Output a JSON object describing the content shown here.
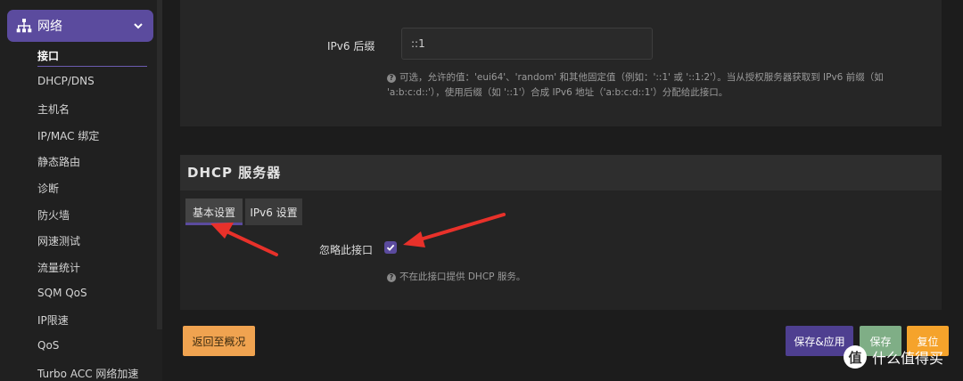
{
  "sidebar": {
    "group_label": "网络",
    "items": [
      {
        "label": "接口",
        "active": true
      },
      {
        "label": "DHCP/DNS"
      },
      {
        "label": "主机名"
      },
      {
        "label": "IP/MAC 绑定"
      },
      {
        "label": "静态路由"
      },
      {
        "label": "诊断"
      },
      {
        "label": "防火墙"
      },
      {
        "label": "网速测试"
      },
      {
        "label": "流量统计"
      },
      {
        "label": "SQM QoS"
      },
      {
        "label": "IP限速"
      },
      {
        "label": "QoS"
      },
      {
        "label": "Turbo ACC 网络加速"
      }
    ]
  },
  "ipv6": {
    "suffix_label": "IPv6 后缀",
    "suffix_value": "::1",
    "hint_line1": "可选，允许的值：'eui64'、'random' 和其他固定值（例如：'::1' 或 '::1:2'）。当从授权服务器获取到 IPv6 前缀（如",
    "hint_line2": "'a:b:c:d::'），使用后缀（如 '::1'）合成 IPv6 地址（'a:b:c:d::1'）分配给此接口。"
  },
  "dhcp": {
    "title": "DHCP 服务器",
    "tabs": [
      "基本设置",
      "IPv6 设置"
    ],
    "ignore_label": "忽略此接口",
    "ignore_checked": true,
    "ignore_hint": "不在此接口提供 DHCP 服务。"
  },
  "buttons": {
    "back": "返回至概况",
    "save_apply": "保存&应用",
    "save": "保存",
    "reset": "复位"
  },
  "watermark": {
    "badge": "值",
    "text": "什么值得买"
  },
  "colors": {
    "accent": "#5b4b9e",
    "back_button": "#f0a350",
    "save_button": "#7fae86",
    "reset_button": "#f5a32b",
    "annotation_arrow": "#e8312a"
  }
}
